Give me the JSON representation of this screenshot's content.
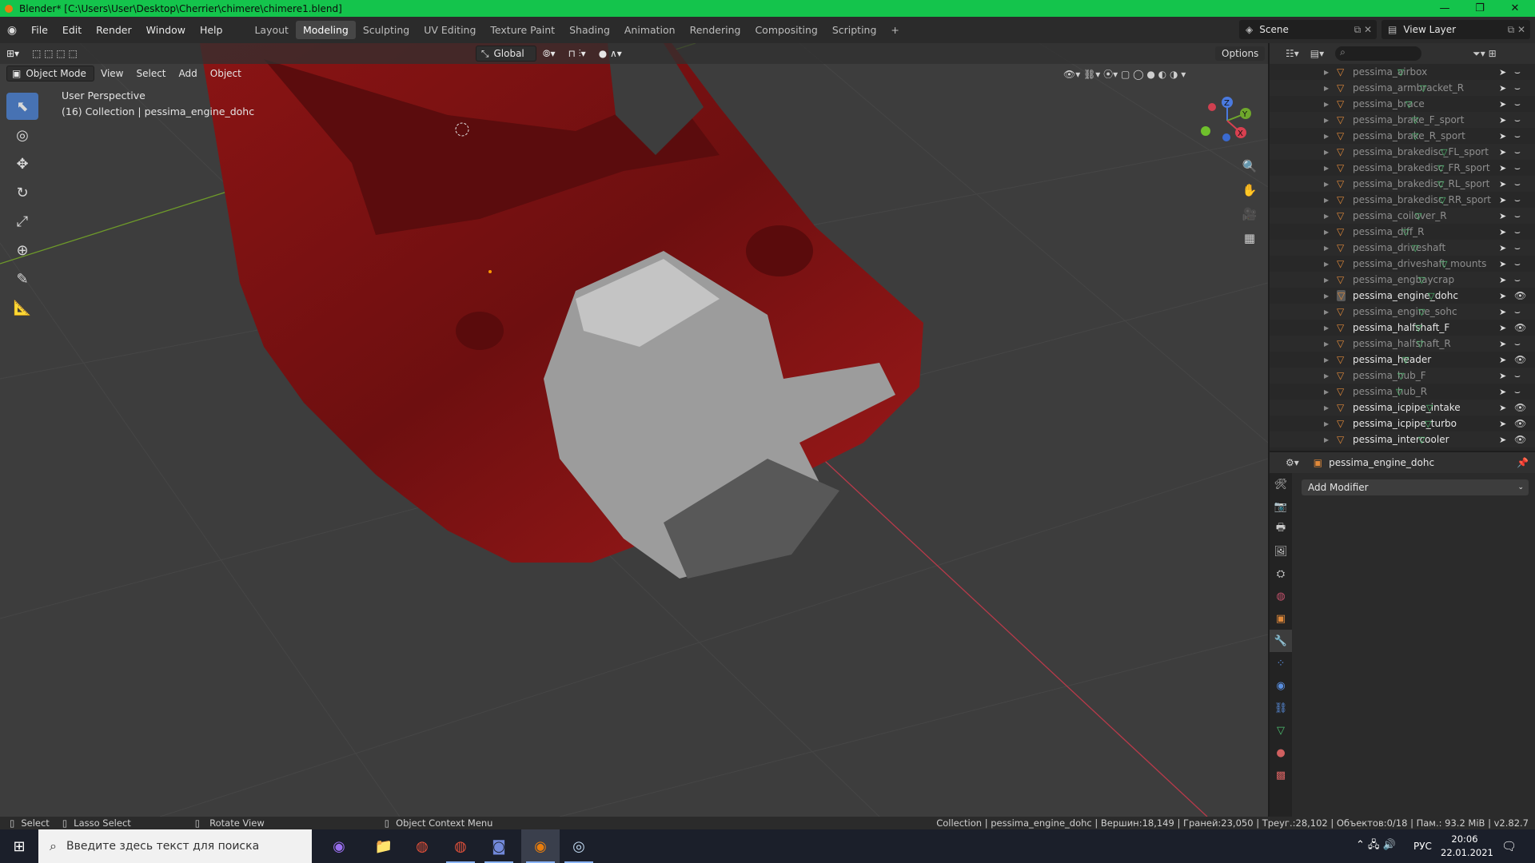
{
  "window": {
    "title": "Blender* [C:\\Users\\User\\Desktop\\Cherrier\\chimere\\chimere1.blend]",
    "minimize": "—",
    "maximize": "❐",
    "close": "✕"
  },
  "menu": [
    "File",
    "Edit",
    "Render",
    "Window",
    "Help"
  ],
  "workspaces": [
    "Layout",
    "Modeling",
    "Sculpting",
    "UV Editing",
    "Texture Paint",
    "Shading",
    "Animation",
    "Rendering",
    "Compositing",
    "Scripting"
  ],
  "active_workspace": "Modeling",
  "add_workspace": "+",
  "scene": {
    "label": "Scene",
    "view_layer": "View Layer"
  },
  "viewport": {
    "orientation": "Global",
    "options": "Options",
    "mode": "Object Mode",
    "menus": [
      "View",
      "Select",
      "Add",
      "Object"
    ],
    "perspective": "User Perspective",
    "collection_info": "(16) Collection | pessima_engine_dohc",
    "gizmo": {
      "z": "Z",
      "y": "Y",
      "x": "X"
    }
  },
  "outliner": {
    "items": [
      {
        "name": "pessima_airbox",
        "visible": false
      },
      {
        "name": "pessima_armbracket_R",
        "visible": false
      },
      {
        "name": "pessima_brace",
        "visible": false
      },
      {
        "name": "pessima_brake_F_sport",
        "visible": false
      },
      {
        "name": "pessima_brake_R_sport",
        "visible": false
      },
      {
        "name": "pessima_brakedisc_FL_sport",
        "visible": false
      },
      {
        "name": "pessima_brakedisc_FR_sport",
        "visible": false
      },
      {
        "name": "pessima_brakedisc_RL_sport",
        "visible": false
      },
      {
        "name": "pessima_brakedisc_RR_sport",
        "visible": false
      },
      {
        "name": "pessima_coilover_R",
        "visible": false
      },
      {
        "name": "pessima_diff_R",
        "visible": false
      },
      {
        "name": "pessima_driveshaft",
        "visible": false
      },
      {
        "name": "pessima_driveshaft_mounts",
        "visible": false
      },
      {
        "name": "pessima_engbaycrap",
        "visible": false
      },
      {
        "name": "pessima_engine_dohc",
        "visible": true,
        "selected": true
      },
      {
        "name": "pessima_engine_sohc",
        "visible": false
      },
      {
        "name": "pessima_halfshaft_F",
        "visible": true
      },
      {
        "name": "pessima_halfshaft_R",
        "visible": false
      },
      {
        "name": "pessima_header",
        "visible": true
      },
      {
        "name": "pessima_hub_F",
        "visible": false
      },
      {
        "name": "pessima_hub_R",
        "visible": false
      },
      {
        "name": "pessima_icpipe_intake",
        "visible": true
      },
      {
        "name": "pessima_icpipe_turbo",
        "visible": true
      },
      {
        "name": "pessima_intercooler",
        "visible": true
      }
    ]
  },
  "properties": {
    "object": "pessima_engine_dohc",
    "add_modifier": "Add Modifier"
  },
  "statusbar": {
    "select": "Select",
    "lasso": "Lasso Select",
    "rotate": "Rotate View",
    "context": "Object Context Menu",
    "stats": "Collection | pessima_engine_dohc | Вершин:18,149 | Граней:23,050 | Треуг.:28,102 | Объектов:0/18 | Пам.: 93.2 MiB | v2.82.7"
  },
  "taskbar": {
    "search_placeholder": "Введите здесь текст для поиска",
    "lang": "РУС",
    "time": "20:06",
    "date": "22.01.2021"
  }
}
